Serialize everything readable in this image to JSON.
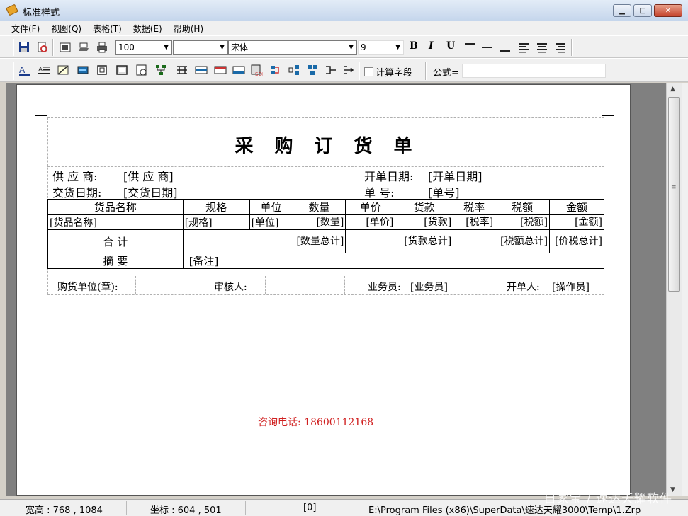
{
  "window": {
    "title": "标准样式"
  },
  "menu": [
    "文件(F)",
    "视图(Q)",
    "表格(T)",
    "数据(E)",
    "帮助(H)"
  ],
  "toolbar": {
    "zoom": "100",
    "style_combo": "",
    "font": "宋体",
    "font_size": "9",
    "bold": "B",
    "italic": "I",
    "underline": "U",
    "calc_field": "计算字段",
    "formula_label": "公式=",
    "formula_value": ""
  },
  "report": {
    "title": "采购订货单",
    "supplier_label": "供 应 商:",
    "supplier_value": "[供 应 商]",
    "order_date_label": "开单日期:",
    "order_date_value": "[开单日期]",
    "delivery_date_label": "交货日期:",
    "delivery_date_value": "[交货日期]",
    "doc_no_label": "单      号:",
    "doc_no_value": "[单号]",
    "headers": [
      "货品名称",
      "规格",
      "单位",
      "数量",
      "单价",
      "货款",
      "税率",
      "税额",
      "金额"
    ],
    "fields": [
      "[货品名称]",
      "[规格]",
      "[单位]",
      "[数量]",
      "[单价]",
      "[货款]",
      "[税率]",
      "[税额]",
      "[金额]"
    ],
    "total_label": "合        计",
    "total_qty": "[数量总计]",
    "total_goods": "[货款总计]",
    "total_tax": "[税额总计]",
    "total_amount": "[价税总计]",
    "summary_label": "摘        要",
    "summary_value": "[备注]",
    "buyer_label": "购货单位(章):",
    "reviewer_label": "审核人:",
    "salesman_label": "业务员:",
    "salesman_value": "[业务员]",
    "issuer_label": "开单人:",
    "issuer_value": "[操作员]",
    "phone": "咨询电话: 18600112168"
  },
  "status": {
    "size": "宽高 : 768 , 1084",
    "coords": "坐标 : 604 , 501",
    "index": "[0]",
    "path": "E:\\Program Files (x86)\\SuperData\\速达天耀3000\\Temp\\1.Zrp"
  },
  "watermark": "自家宝 / 速达天耀软件"
}
